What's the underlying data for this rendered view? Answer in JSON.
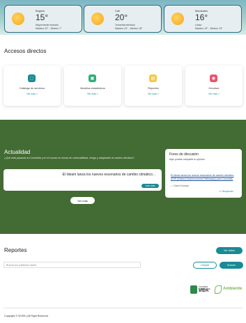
{
  "weather": [
    {
      "city": "Bogotá",
      "temp": "15°",
      "description": "Mayormente soleado",
      "range": "Máximo 22° - Mínimo 7°"
    },
    {
      "city": "Cali",
      "temp": "20°",
      "description": "Tormenta eléctrica",
      "range": "Máximo 24° - Mínimo 18°"
    },
    {
      "city": "Manizales",
      "temp": "16°",
      "description": "Lluvia",
      "range": "Máximo 19° - Mínimo 13°"
    }
  ],
  "accesos": {
    "title": "Accesos directos",
    "cards": [
      {
        "label": "Catálogo de servicios",
        "link": "Ver más  >",
        "icon": "catalog-icon",
        "color": "#1a8a94",
        "glyph": "⬚"
      },
      {
        "label": "Modelos estadísticos",
        "link": "Ver más  >",
        "icon": "chart-icon",
        "color": "#2fae7a",
        "glyph": "▣"
      },
      {
        "label": "Reportes",
        "link": "Ver más  >",
        "icon": "report-icon",
        "color": "#f2c94c",
        "glyph": "▤"
      },
      {
        "label": "Geovisor",
        "link": "Ver más  >",
        "icon": "map-pin-icon",
        "color": "#e8556d",
        "glyph": "◉"
      }
    ]
  },
  "actualidad": {
    "title": "Actualidad",
    "subtitle": "¿Qué está pasando en Colombia y en el mundo en temas de vulnerabilidad, riesgo y adaptación al cambio climático?",
    "news_text": "El Ideam lanza los nuevos escenarios de cambio climático...",
    "read_label": "Leer más",
    "more_label": "Ver más"
  },
  "foro": {
    "title": "Foros de discusión",
    "subtitle": "Aquí podrás compartir tu opinión.",
    "link": "El Ideam lanza los nuevos escenarios de cambio climático (SSP (Shared Socioeconomic Pathways)) para Colombia.",
    "author": "— Daniel Naranjo",
    "reply": "<< Responder"
  },
  "reportes": {
    "title": "Reportes",
    "ver_todos": "Ver todos",
    "search_placeholder": "Buscar por palabras claves",
    "clear": "Limpiar",
    "search": "Buscar"
  },
  "logos": {
    "cv_small": "COLOMBIA POTENCIA DE LA",
    "cv_big": "VIDA",
    "ambiente": "Ambiente"
  },
  "footer": {
    "copyright": "Copyright © SIVRA | All Right Reserved"
  }
}
